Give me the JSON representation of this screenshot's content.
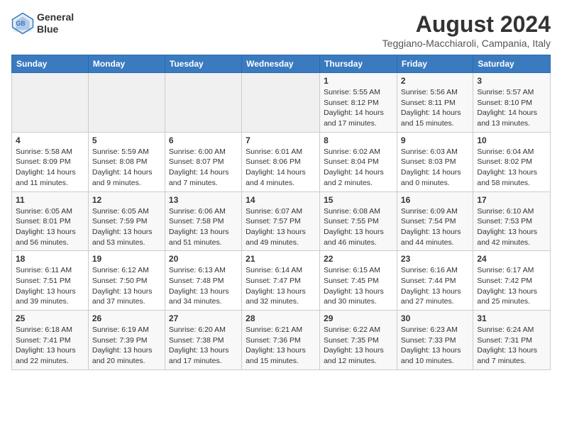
{
  "logo": {
    "line1": "General",
    "line2": "Blue"
  },
  "title": "August 2024",
  "location": "Teggiano-Macchiaroli, Campania, Italy",
  "days_of_week": [
    "Sunday",
    "Monday",
    "Tuesday",
    "Wednesday",
    "Thursday",
    "Friday",
    "Saturday"
  ],
  "weeks": [
    [
      {
        "day": "",
        "info": ""
      },
      {
        "day": "",
        "info": ""
      },
      {
        "day": "",
        "info": ""
      },
      {
        "day": "",
        "info": ""
      },
      {
        "day": "1",
        "info": "Sunrise: 5:55 AM\nSunset: 8:12 PM\nDaylight: 14 hours\nand 17 minutes."
      },
      {
        "day": "2",
        "info": "Sunrise: 5:56 AM\nSunset: 8:11 PM\nDaylight: 14 hours\nand 15 minutes."
      },
      {
        "day": "3",
        "info": "Sunrise: 5:57 AM\nSunset: 8:10 PM\nDaylight: 14 hours\nand 13 minutes."
      }
    ],
    [
      {
        "day": "4",
        "info": "Sunrise: 5:58 AM\nSunset: 8:09 PM\nDaylight: 14 hours\nand 11 minutes."
      },
      {
        "day": "5",
        "info": "Sunrise: 5:59 AM\nSunset: 8:08 PM\nDaylight: 14 hours\nand 9 minutes."
      },
      {
        "day": "6",
        "info": "Sunrise: 6:00 AM\nSunset: 8:07 PM\nDaylight: 14 hours\nand 7 minutes."
      },
      {
        "day": "7",
        "info": "Sunrise: 6:01 AM\nSunset: 8:06 PM\nDaylight: 14 hours\nand 4 minutes."
      },
      {
        "day": "8",
        "info": "Sunrise: 6:02 AM\nSunset: 8:04 PM\nDaylight: 14 hours\nand 2 minutes."
      },
      {
        "day": "9",
        "info": "Sunrise: 6:03 AM\nSunset: 8:03 PM\nDaylight: 14 hours\nand 0 minutes."
      },
      {
        "day": "10",
        "info": "Sunrise: 6:04 AM\nSunset: 8:02 PM\nDaylight: 13 hours\nand 58 minutes."
      }
    ],
    [
      {
        "day": "11",
        "info": "Sunrise: 6:05 AM\nSunset: 8:01 PM\nDaylight: 13 hours\nand 56 minutes."
      },
      {
        "day": "12",
        "info": "Sunrise: 6:05 AM\nSunset: 7:59 PM\nDaylight: 13 hours\nand 53 minutes."
      },
      {
        "day": "13",
        "info": "Sunrise: 6:06 AM\nSunset: 7:58 PM\nDaylight: 13 hours\nand 51 minutes."
      },
      {
        "day": "14",
        "info": "Sunrise: 6:07 AM\nSunset: 7:57 PM\nDaylight: 13 hours\nand 49 minutes."
      },
      {
        "day": "15",
        "info": "Sunrise: 6:08 AM\nSunset: 7:55 PM\nDaylight: 13 hours\nand 46 minutes."
      },
      {
        "day": "16",
        "info": "Sunrise: 6:09 AM\nSunset: 7:54 PM\nDaylight: 13 hours\nand 44 minutes."
      },
      {
        "day": "17",
        "info": "Sunrise: 6:10 AM\nSunset: 7:53 PM\nDaylight: 13 hours\nand 42 minutes."
      }
    ],
    [
      {
        "day": "18",
        "info": "Sunrise: 6:11 AM\nSunset: 7:51 PM\nDaylight: 13 hours\nand 39 minutes."
      },
      {
        "day": "19",
        "info": "Sunrise: 6:12 AM\nSunset: 7:50 PM\nDaylight: 13 hours\nand 37 minutes."
      },
      {
        "day": "20",
        "info": "Sunrise: 6:13 AM\nSunset: 7:48 PM\nDaylight: 13 hours\nand 34 minutes."
      },
      {
        "day": "21",
        "info": "Sunrise: 6:14 AM\nSunset: 7:47 PM\nDaylight: 13 hours\nand 32 minutes."
      },
      {
        "day": "22",
        "info": "Sunrise: 6:15 AM\nSunset: 7:45 PM\nDaylight: 13 hours\nand 30 minutes."
      },
      {
        "day": "23",
        "info": "Sunrise: 6:16 AM\nSunset: 7:44 PM\nDaylight: 13 hours\nand 27 minutes."
      },
      {
        "day": "24",
        "info": "Sunrise: 6:17 AM\nSunset: 7:42 PM\nDaylight: 13 hours\nand 25 minutes."
      }
    ],
    [
      {
        "day": "25",
        "info": "Sunrise: 6:18 AM\nSunset: 7:41 PM\nDaylight: 13 hours\nand 22 minutes."
      },
      {
        "day": "26",
        "info": "Sunrise: 6:19 AM\nSunset: 7:39 PM\nDaylight: 13 hours\nand 20 minutes."
      },
      {
        "day": "27",
        "info": "Sunrise: 6:20 AM\nSunset: 7:38 PM\nDaylight: 13 hours\nand 17 minutes."
      },
      {
        "day": "28",
        "info": "Sunrise: 6:21 AM\nSunset: 7:36 PM\nDaylight: 13 hours\nand 15 minutes."
      },
      {
        "day": "29",
        "info": "Sunrise: 6:22 AM\nSunset: 7:35 PM\nDaylight: 13 hours\nand 12 minutes."
      },
      {
        "day": "30",
        "info": "Sunrise: 6:23 AM\nSunset: 7:33 PM\nDaylight: 13 hours\nand 10 minutes."
      },
      {
        "day": "31",
        "info": "Sunrise: 6:24 AM\nSunset: 7:31 PM\nDaylight: 13 hours\nand 7 minutes."
      }
    ]
  ]
}
